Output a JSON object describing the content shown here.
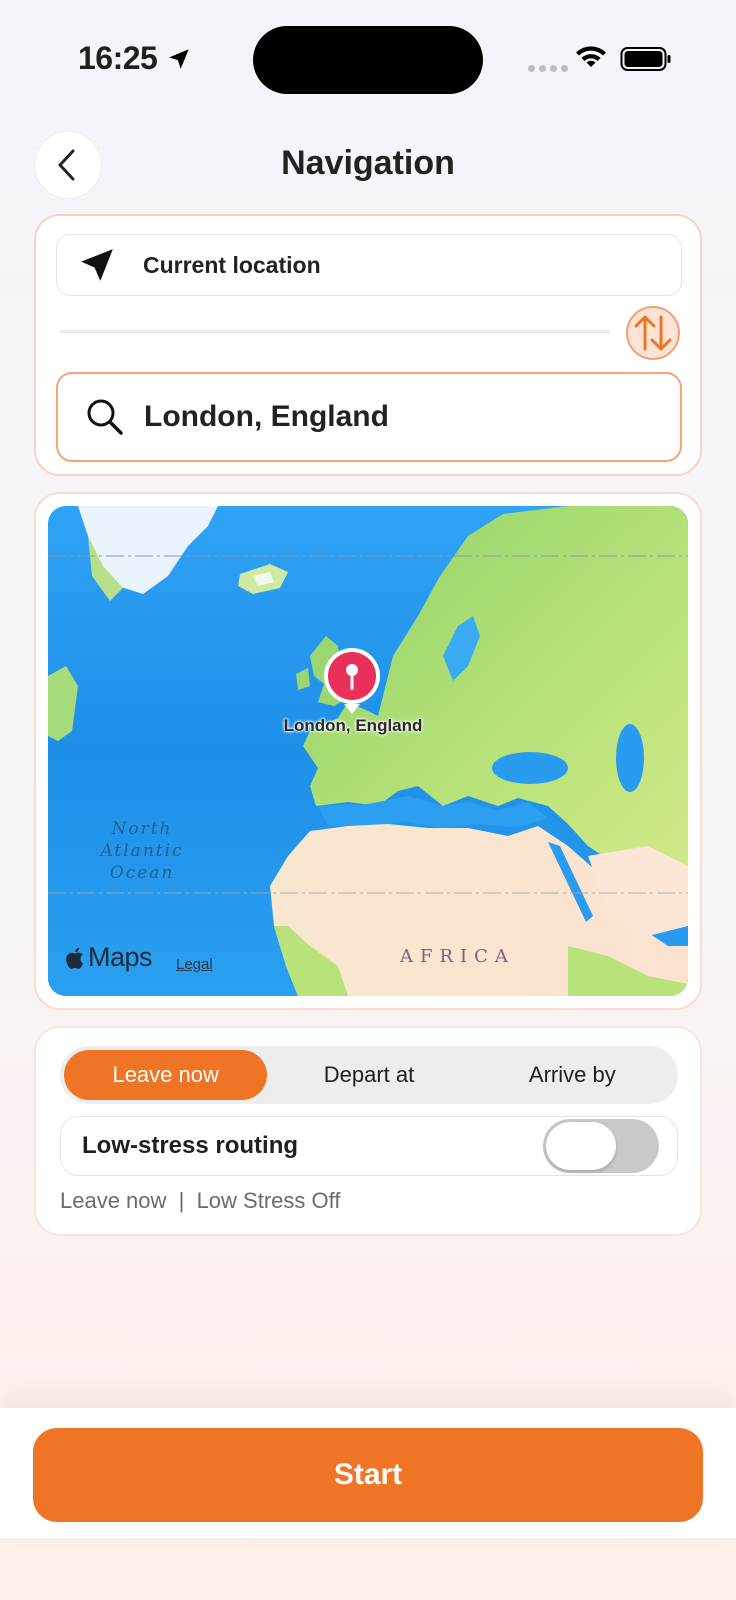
{
  "status_bar": {
    "time": "16:25",
    "icons": [
      "location-arrow-icon",
      "signal-dots-icon",
      "wifi-icon",
      "battery-icon"
    ]
  },
  "header": {
    "title": "Navigation",
    "back_icon": "chevron-left-icon"
  },
  "route": {
    "origin_label": "Current location",
    "origin_icon": "navigation-arrow-icon",
    "swap_icon": "swap-arrows-icon",
    "destination_value": "London, England",
    "destination_icon": "search-icon"
  },
  "map": {
    "pin_label": "London, England",
    "ocean_label_lines": [
      "North",
      "Atlantic",
      "Ocean"
    ],
    "continent_label": "AFRICA",
    "attribution_logo": "Maps",
    "legal_link": "Legal"
  },
  "options": {
    "modes": [
      {
        "label": "Leave now",
        "selected": true
      },
      {
        "label": "Depart at",
        "selected": false
      },
      {
        "label": "Arrive by",
        "selected": false
      }
    ],
    "low_stress_label": "Low-stress routing",
    "low_stress_on": false,
    "summary": "Leave now  |  Low Stress Off"
  },
  "actions": {
    "start_label": "Start"
  },
  "colors": {
    "accent": "#f07426",
    "accent_light": "#fde3d3",
    "pin": "#e8305a"
  }
}
